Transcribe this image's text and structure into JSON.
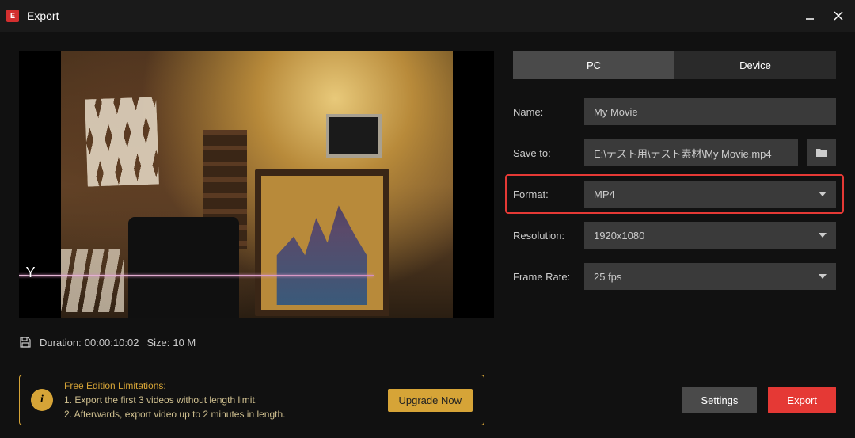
{
  "titlebar": {
    "title": "Export"
  },
  "tabs": {
    "pc": "PC",
    "device": "Device",
    "active": "pc"
  },
  "form": {
    "name": {
      "label": "Name:",
      "value": "My Movie"
    },
    "save_to": {
      "label": "Save to:",
      "value": "E:\\テスト用\\テスト素材\\My Movie.mp4"
    },
    "format": {
      "label": "Format:",
      "value": "MP4"
    },
    "resolution": {
      "label": "Resolution:",
      "value": "1920x1080"
    },
    "frame_rate": {
      "label": "Frame Rate:",
      "value": "25 fps"
    }
  },
  "info": {
    "duration_label": "Duration:",
    "duration_value": "00:00:10:02",
    "size_label": "Size:",
    "size_value": "10 M"
  },
  "preview": {
    "marker_letter": "Y"
  },
  "limitations": {
    "title": "Free Edition Limitations:",
    "line1": "1. Export the first 3 videos without length limit.",
    "line2": "2. Afterwards, export video up to 2 minutes in length.",
    "upgrade": "Upgrade Now"
  },
  "buttons": {
    "settings": "Settings",
    "export": "Export"
  }
}
